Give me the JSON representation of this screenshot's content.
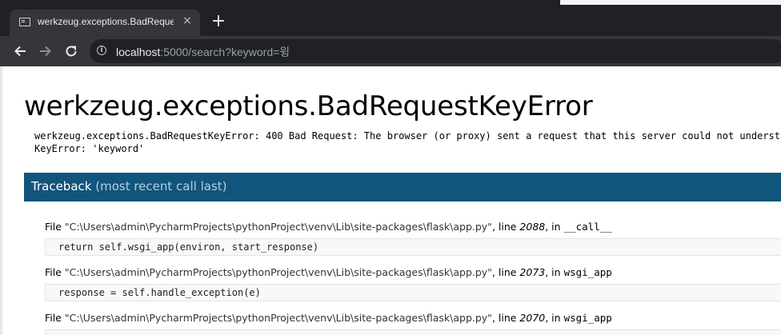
{
  "browser": {
    "tab_title": "werkzeug.exceptions.BadRequestKeyError",
    "tab_close": "×",
    "new_tab": "+",
    "url_host": "localhost",
    "url_rest": ":5000/search?keyword=윙"
  },
  "error": {
    "title": "werkzeug.exceptions.BadRequestKeyError",
    "message_line1": "werkzeug.exceptions.BadRequestKeyError: 400 Bad Request: The browser (or proxy) sent a request that this server could not understand.",
    "message_line2": "KeyError: 'keyword'"
  },
  "traceback": {
    "title": "Traceback",
    "subtitle": "(most recent call last)",
    "frames": [
      {
        "file_prefix": "File ",
        "file": "\"C:\\Users\\admin\\PycharmProjects\\pythonProject\\venv\\Lib\\site-packages\\flask\\app.py\"",
        "line_prefix": ", line ",
        "line": "2088",
        "in_prefix": ", in ",
        "function": "__call__",
        "code": "return self.wsgi_app(environ, start_response)"
      },
      {
        "file_prefix": "File ",
        "file": "\"C:\\Users\\admin\\PycharmProjects\\pythonProject\\venv\\Lib\\site-packages\\flask\\app.py\"",
        "line_prefix": ", line ",
        "line": "2073",
        "in_prefix": ", in ",
        "function": "wsgi_app",
        "code": "response = self.handle_exception(e)"
      },
      {
        "file_prefix": "File ",
        "file": "\"C:\\Users\\admin\\PycharmProjects\\pythonProject\\venv\\Lib\\site-packages\\flask\\app.py\"",
        "line_prefix": ", line ",
        "line": "2070",
        "in_prefix": ", in ",
        "function": "wsgi_app",
        "code": ""
      }
    ]
  },
  "icons": {
    "back": "back-arrow-icon",
    "forward": "forward-arrow-icon",
    "reload": "reload-icon",
    "info": "info-icon",
    "favicon": "terminal-favicon-icon"
  },
  "colors": {
    "traceback_header": "#11557c",
    "chrome_dark": "#202124",
    "toolbar": "#35363a"
  }
}
